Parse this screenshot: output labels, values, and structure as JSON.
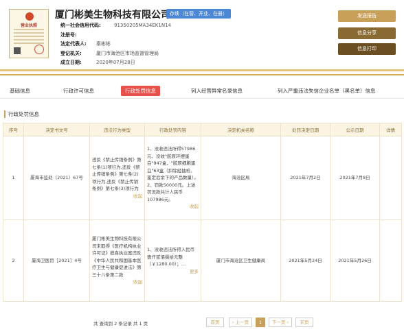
{
  "company": {
    "name": "厦门彬美生物科技有限公司",
    "status": "存续（在营、开业、在册）",
    "license_title": "营业执照",
    "fields": [
      {
        "label": "统一社会信用代码:",
        "value": "91350205MA34EK1N14"
      },
      {
        "label": "注册号:",
        "value": ""
      },
      {
        "label": "法定代表人:",
        "value": "秦彬彬"
      },
      {
        "label": "登记机关:",
        "value": "厦门市海沧区市场监督管理局"
      },
      {
        "label": "成立日期:",
        "value": "2020年07月28日"
      }
    ]
  },
  "buttons": {
    "report": "发送报告",
    "share": "信息分享",
    "print": "信息打印"
  },
  "tabs": [
    "基础信息",
    "行政许可信息",
    "行政处罚信息",
    "列入经营异常名录信息",
    "列入严重违法失信企业名单（黑名单）信息"
  ],
  "section_title": "行政处罚信息",
  "table": {
    "headers": [
      "序号",
      "决定书文号",
      "违法行为类型",
      "行政处罚内容",
      "决定机关名称",
      "处罚决定日期",
      "公示日期",
      "详情"
    ],
    "rows": [
      {
        "no": "1",
        "doc": "厦海市监处（2021）67号",
        "type": "违反《禁止传销条例》第七条(1)项行为,违反《禁止传销条例》第七条(2)项行为,违反《禁止传销条例》第七条(3)项行为",
        "type_more": "收起",
        "content": "1、没收违法所得57986元、没收\"胶原环摆蛋白\"947盒、\"胶原细胞蛋白\"63盒（扣除经抽检、鉴定后余下的产品数量）。2、罚款50000元。上述罚没款共计人民币107986元。",
        "content_more": "收起",
        "org": "海沧区局",
        "decide_date": "2021年7月2日",
        "publish_date": "2021年7月8日",
        "detail": ""
      },
      {
        "no": "2",
        "doc": "厦海卫医罚［2021］4号",
        "type": "厦门彬美生物科技有限公司未取得《医疗机构执业许可证》擅自执业案违反《中华人民共和国基本医疗卫生与健康促进法》第三十八条第二款",
        "type_more": "收起",
        "content": "1、没收违法所得人民币壹仟贰佰捌拾元整（￥1280.00）；…",
        "content_more": "更多",
        "org": "厦门市海沧区卫生健康局",
        "decide_date": "2021年5月24日",
        "publish_date": "2021年5月26日",
        "detail": ""
      }
    ]
  },
  "pager": {
    "total": "共 查询到 2 条记录 共 1 页",
    "first": "首页",
    "prev": "‹ 上一页",
    "current": "1",
    "next": "下一页 ›",
    "last": "末页"
  }
}
